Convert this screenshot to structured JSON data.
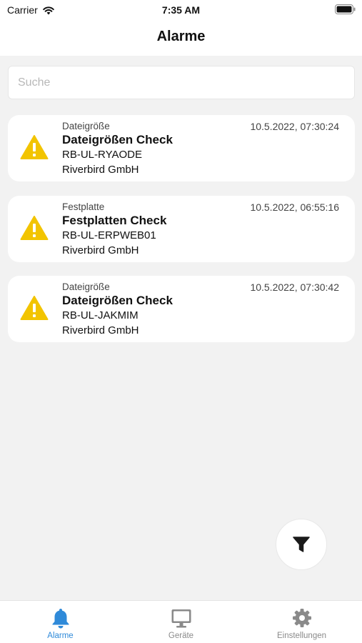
{
  "status_bar": {
    "carrier": "Carrier",
    "time": "7:35 AM"
  },
  "header": {
    "title": "Alarme"
  },
  "search": {
    "placeholder": "Suche",
    "value": ""
  },
  "alarms": [
    {
      "icon": "warning-triangle-icon",
      "category": "Dateigröße",
      "timestamp": "10.5.2022, 07:30:24",
      "name": "Dateigrößen Check",
      "device": "RB-UL-RYAODE",
      "company": "Riverbird GmbH"
    },
    {
      "icon": "warning-triangle-icon",
      "category": "Festplatte",
      "timestamp": "10.5.2022, 06:55:16",
      "name": "Festplatten Check",
      "device": "RB-UL-ERPWEB01",
      "company": "Riverbird GmbH"
    },
    {
      "icon": "warning-triangle-icon",
      "category": "Dateigröße",
      "timestamp": "10.5.2022, 07:30:42",
      "name": "Dateigrößen Check",
      "device": "RB-UL-JAKMIM",
      "company": "Riverbird GmbH"
    }
  ],
  "fab": {
    "icon": "filter-icon"
  },
  "tabbar": {
    "tabs": [
      {
        "label": "Alarme",
        "icon": "bell-icon",
        "active": true
      },
      {
        "label": "Geräte",
        "icon": "monitor-icon",
        "active": false
      },
      {
        "label": "Einstellungen",
        "icon": "gear-icon",
        "active": false
      }
    ]
  },
  "colors": {
    "background": "#f2f2f2",
    "card": "#ffffff",
    "warning": "#f2c400",
    "accent": "#2f8ad9",
    "inactive": "#8a8a8a"
  }
}
